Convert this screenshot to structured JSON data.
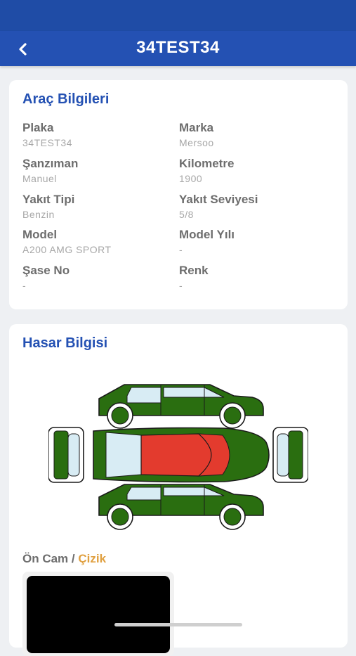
{
  "header": {
    "title": "34TEST34"
  },
  "vehicle_info": {
    "title": "Araç Bilgileri",
    "fields": [
      {
        "label": "Plaka",
        "value": "34TEST34"
      },
      {
        "label": "Marka",
        "value": "Mersoo"
      },
      {
        "label": "Şanzıman",
        "value": "Manuel"
      },
      {
        "label": "Kilometre",
        "value": "1900"
      },
      {
        "label": "Yakıt Tipi",
        "value": "Benzin"
      },
      {
        "label": "Yakıt Seviyesi",
        "value": "5/8"
      },
      {
        "label": "Model",
        "value": "A200 AMG SPORT"
      },
      {
        "label": "Model Yılı",
        "value": "-"
      },
      {
        "label": "Şase No",
        "value": "-"
      },
      {
        "label": "Renk",
        "value": "-"
      }
    ]
  },
  "damage_info": {
    "title": "Hasar Bilgisi",
    "colors": {
      "intact": "#2a6e10",
      "damaged": "#e33b2e",
      "glass": "#d8ecf4"
    },
    "damage": {
      "part": "Ön Cam",
      "separator": "/",
      "type": "Çizik"
    }
  }
}
